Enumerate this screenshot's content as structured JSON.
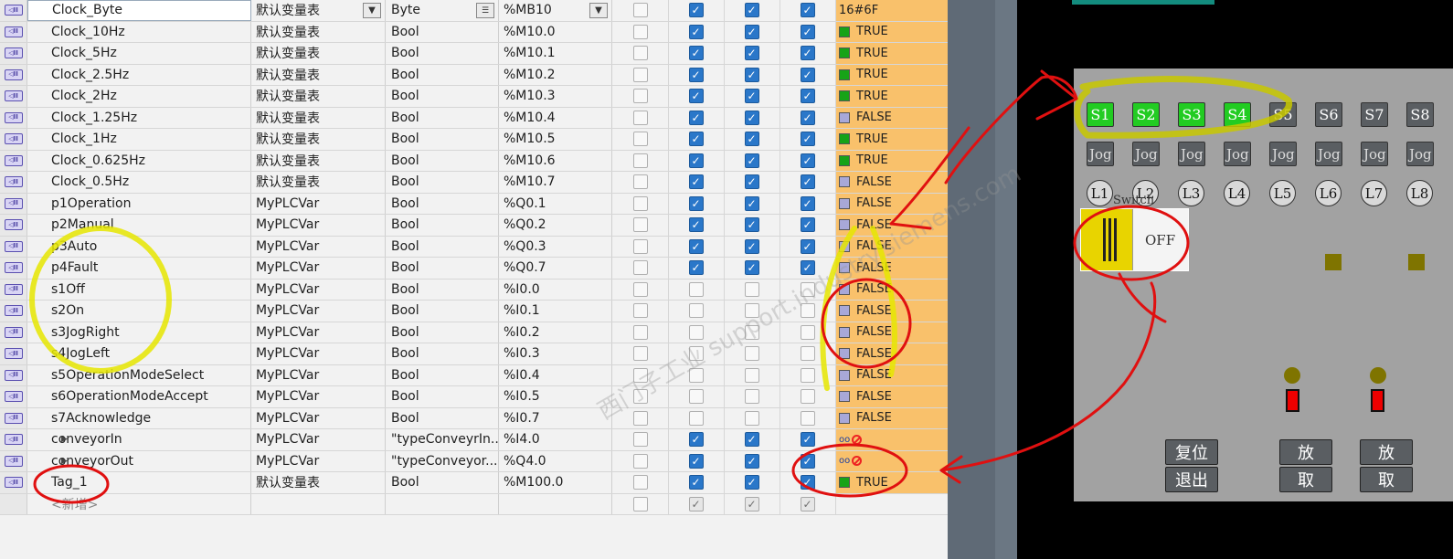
{
  "tag_rows": [
    {
      "name": "Clock_Byte",
      "table": "默认变量表",
      "type": "Byte",
      "address": "%MB10",
      "cb": [
        false,
        true,
        true,
        true
      ],
      "monitor": "16#6F",
      "mon_state": "none",
      "selected": true
    },
    {
      "name": "Clock_10Hz",
      "table": "默认变量表",
      "type": "Bool",
      "address": "%M10.0",
      "cb": [
        false,
        true,
        true,
        true
      ],
      "monitor": "TRUE",
      "mon_state": "true"
    },
    {
      "name": "Clock_5Hz",
      "table": "默认变量表",
      "type": "Bool",
      "address": "%M10.1",
      "cb": [
        false,
        true,
        true,
        true
      ],
      "monitor": "TRUE",
      "mon_state": "true"
    },
    {
      "name": "Clock_2.5Hz",
      "table": "默认变量表",
      "type": "Bool",
      "address": "%M10.2",
      "cb": [
        false,
        true,
        true,
        true
      ],
      "monitor": "TRUE",
      "mon_state": "true"
    },
    {
      "name": "Clock_2Hz",
      "table": "默认变量表",
      "type": "Bool",
      "address": "%M10.3",
      "cb": [
        false,
        true,
        true,
        true
      ],
      "monitor": "TRUE",
      "mon_state": "true"
    },
    {
      "name": "Clock_1.25Hz",
      "table": "默认变量表",
      "type": "Bool",
      "address": "%M10.4",
      "cb": [
        false,
        true,
        true,
        true
      ],
      "monitor": "FALSE",
      "mon_state": "false"
    },
    {
      "name": "Clock_1Hz",
      "table": "默认变量表",
      "type": "Bool",
      "address": "%M10.5",
      "cb": [
        false,
        true,
        true,
        true
      ],
      "monitor": "TRUE",
      "mon_state": "true"
    },
    {
      "name": "Clock_0.625Hz",
      "table": "默认变量表",
      "type": "Bool",
      "address": "%M10.6",
      "cb": [
        false,
        true,
        true,
        true
      ],
      "monitor": "TRUE",
      "mon_state": "true"
    },
    {
      "name": "Clock_0.5Hz",
      "table": "默认变量表",
      "type": "Bool",
      "address": "%M10.7",
      "cb": [
        false,
        true,
        true,
        true
      ],
      "monitor": "FALSE",
      "mon_state": "false"
    },
    {
      "name": "p1Operation",
      "table": "MyPLCVar",
      "type": "Bool",
      "address": "%Q0.1",
      "cb": [
        false,
        true,
        true,
        true
      ],
      "monitor": "FALSE",
      "mon_state": "false"
    },
    {
      "name": "p2Manual",
      "table": "MyPLCVar",
      "type": "Bool",
      "address": "%Q0.2",
      "cb": [
        false,
        true,
        true,
        true
      ],
      "monitor": "FALSE",
      "mon_state": "false"
    },
    {
      "name": "p3Auto",
      "table": "MyPLCVar",
      "type": "Bool",
      "address": "%Q0.3",
      "cb": [
        false,
        true,
        true,
        true
      ],
      "monitor": "FALSE",
      "mon_state": "false"
    },
    {
      "name": "p4Fault",
      "table": "MyPLCVar",
      "type": "Bool",
      "address": "%Q0.7",
      "cb": [
        false,
        true,
        true,
        true
      ],
      "monitor": "FALSE",
      "mon_state": "false"
    },
    {
      "name": "s1Off",
      "table": "MyPLCVar",
      "type": "Bool",
      "address": "%I0.0",
      "cb": [
        false,
        false,
        false,
        false
      ],
      "monitor": "FALSE",
      "mon_state": "false"
    },
    {
      "name": "s2On",
      "table": "MyPLCVar",
      "type": "Bool",
      "address": "%I0.1",
      "cb": [
        false,
        false,
        false,
        false
      ],
      "monitor": "FALSE",
      "mon_state": "false"
    },
    {
      "name": "s3JogRight",
      "table": "MyPLCVar",
      "type": "Bool",
      "address": "%I0.2",
      "cb": [
        false,
        false,
        false,
        false
      ],
      "monitor": "FALSE",
      "mon_state": "false"
    },
    {
      "name": "s4JogLeft",
      "table": "MyPLCVar",
      "type": "Bool",
      "address": "%I0.3",
      "cb": [
        false,
        false,
        false,
        false
      ],
      "monitor": "FALSE",
      "mon_state": "false"
    },
    {
      "name": "s5OperationModeSelect",
      "table": "MyPLCVar",
      "type": "Bool",
      "address": "%I0.4",
      "cb": [
        false,
        false,
        false,
        false
      ],
      "monitor": "FALSE",
      "mon_state": "false"
    },
    {
      "name": "s6OperationModeAccept",
      "table": "MyPLCVar",
      "type": "Bool",
      "address": "%I0.5",
      "cb": [
        false,
        false,
        false,
        false
      ],
      "monitor": "FALSE",
      "mon_state": "false"
    },
    {
      "name": "s7Acknowledge",
      "table": "MyPLCVar",
      "type": "Bool",
      "address": "%I0.7",
      "cb": [
        false,
        false,
        false,
        false
      ],
      "monitor": "FALSE",
      "mon_state": "false"
    },
    {
      "name": "conveyorIn",
      "table": "MyPLCVar",
      "type": "\"typeConveyrIn...",
      "address": "%I4.0",
      "cb": [
        false,
        true,
        true,
        true
      ],
      "monitor": "",
      "mon_state": "struct",
      "expand": true
    },
    {
      "name": "conveyorOut",
      "table": "MyPLCVar",
      "type": "\"typeConveyor...",
      "address": "%Q4.0",
      "cb": [
        false,
        true,
        true,
        true
      ],
      "monitor": "",
      "mon_state": "struct",
      "expand": true
    },
    {
      "name": "Tag_1",
      "table": "默认变量表",
      "type": "Bool",
      "address": "%M100.0",
      "cb": [
        false,
        true,
        true,
        true
      ],
      "monitor": "TRUE",
      "mon_state": "true"
    }
  ],
  "new_row_label": "<新增>",
  "tag_icon_label": "◁II",
  "watermark": "西门子工业 support.industry.siemens.com",
  "hmi": {
    "s_buttons": [
      {
        "label": "S1",
        "active": true
      },
      {
        "label": "S2",
        "active": true
      },
      {
        "label": "S3",
        "active": true
      },
      {
        "label": "S4",
        "active": true
      },
      {
        "label": "S5",
        "active": false
      },
      {
        "label": "S6",
        "active": false
      },
      {
        "label": "S7",
        "active": false
      },
      {
        "label": "S8",
        "active": false
      }
    ],
    "jog_label": "Jog",
    "lamps": [
      "L1",
      "L2",
      "L3",
      "L4",
      "L5",
      "L6",
      "L7",
      "L8"
    ],
    "switch_label": "Switch",
    "switch_state": "OFF",
    "ctrl_buttons": [
      {
        "top": "复位",
        "bottom": "退出"
      },
      {
        "top": "放",
        "bottom": "取"
      },
      {
        "top": "放",
        "bottom": "取"
      }
    ]
  },
  "colors": {
    "monitor_bg": "#f9c16b",
    "true_green": "#17a317",
    "button_green": "#22cc22",
    "panel_grey": "#a2a2a2",
    "annotation_red": "#e01010",
    "annotation_yellow": "#e6e600"
  }
}
